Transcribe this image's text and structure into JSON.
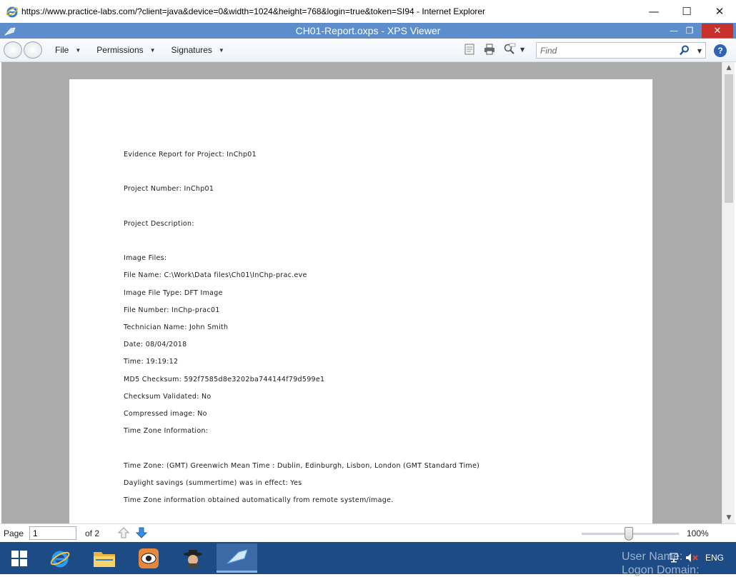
{
  "browser": {
    "title": "https://www.practice-labs.com/?client=java&device=0&width=1024&height=768&login=true&token=SI94 - Internet Explorer",
    "minimize": "—",
    "maximize": "☐",
    "close": "✕"
  },
  "app": {
    "title": "CH01-Report.oxps - XPS Viewer",
    "minimize": "—",
    "restore": "❐",
    "close": "✕"
  },
  "toolbar": {
    "menus": [
      {
        "label": "File",
        "caret": "▼"
      },
      {
        "label": "Permissions",
        "caret": "▼"
      },
      {
        "label": "Signatures",
        "caret": "▼"
      }
    ],
    "find_placeholder": "Find",
    "find_caret": "▼",
    "help": "?"
  },
  "document": {
    "lines": [
      "Evidence Report for Project: InChp01",
      "Project Number: InChp01",
      "Project Description:",
      "Image Files:",
      "File Name: C:\\Work\\Data files\\Ch01\\InChp-prac.eve",
      "Image File Type: DFT Image",
      "File Number: InChp-prac01",
      "Technician Name: John Smith",
      "Date: 08/04/2018",
      "Time: 19:19:12",
      "MD5 Checksum: 592f7585d8e3202ba744144f79d599e1",
      "Checksum Validated: No",
      "Compressed image: No",
      "Time Zone Information:",
      "Time Zone: (GMT) Greenwich Mean Time : Dublin, Edinburgh, Lisbon, London (GMT Standard Time)",
      "Daylight savings (summertime) was in effect: Yes",
      "Time Zone information obtained automatically from remote system/image."
    ]
  },
  "scrollbar": {
    "up": "▲",
    "down": "▼"
  },
  "status": {
    "page_label": "Page",
    "page_value": "1",
    "of_label": "of 2",
    "zoom": "100%"
  },
  "taskbar": {
    "user_name": "User Name:",
    "logon_domain": "Logon Domain:",
    "language": "ENG"
  }
}
